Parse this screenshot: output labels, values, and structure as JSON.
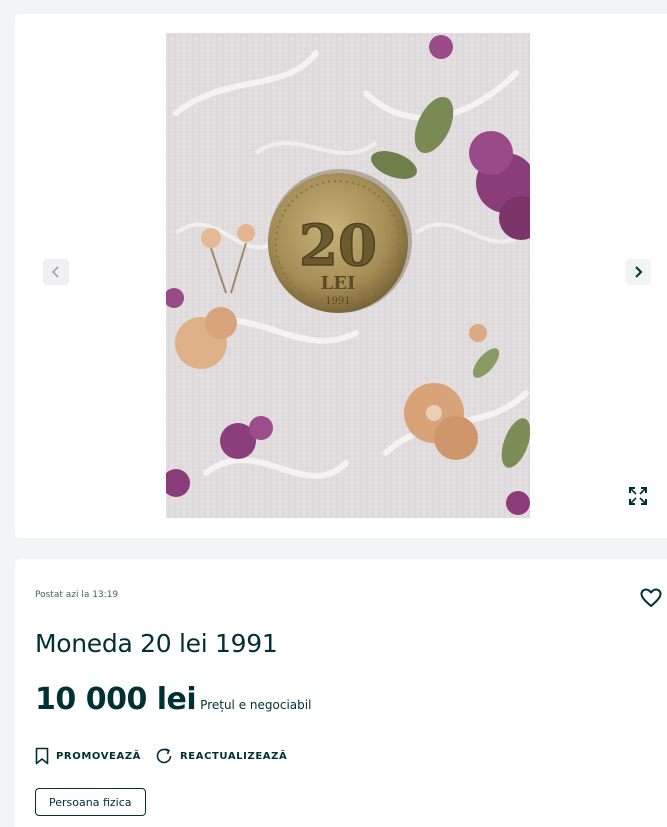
{
  "gallery": {
    "coin_denomination": "20",
    "coin_unit": "LEI",
    "coin_year": "1991"
  },
  "listing": {
    "posted": "Postat azi la 13:19",
    "title": "Moneda 20 lei 1991",
    "price": "10 000 lei",
    "negotiable": "Prețul e negociabil",
    "promote_label": "PROMOVEAZĂ",
    "refresh_label": "REACTUALIZEAZĂ",
    "seller_type": "Persoana fizica"
  },
  "icons": {
    "prev": "chevron-left-icon",
    "next": "chevron-right-icon",
    "expand": "expand-icon",
    "favorite": "heart-icon",
    "promote": "bookmark-icon",
    "refresh": "refresh-icon"
  },
  "colors": {
    "text": "#002f34",
    "page_background": "#f2f4f5",
    "card_background": "#ffffff"
  }
}
